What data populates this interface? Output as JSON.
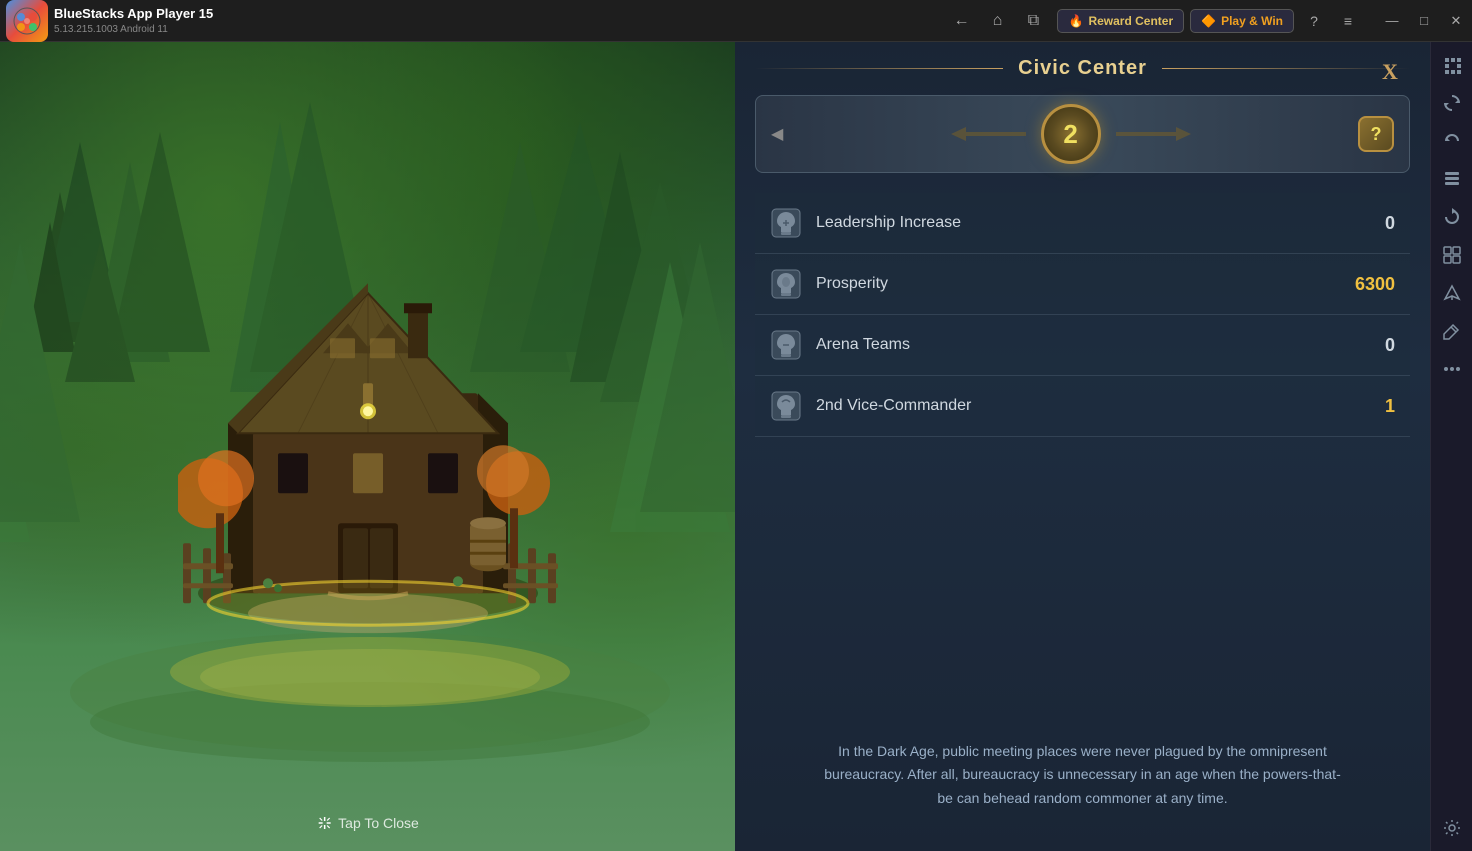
{
  "titlebar": {
    "app_name": "BlueStacks App Player 15",
    "version": "5.13.215.1003  Android 11",
    "nav": {
      "back": "←",
      "home": "⌂",
      "recent": "⧉"
    },
    "reward_center_label": "Reward Center",
    "play_win_label": "Play & Win",
    "reward_icon": "🔥",
    "play_icon": "🔶"
  },
  "window_controls": {
    "help": "?",
    "menu": "≡",
    "minimize": "—",
    "maximize": "□",
    "close": "✕"
  },
  "panel": {
    "title": "Civic Center",
    "close_label": "X",
    "level": "2",
    "help_label": "?"
  },
  "stats": [
    {
      "id": "leadership-increase",
      "name": "Leadership Increase",
      "value": "0",
      "value_type": "zero"
    },
    {
      "id": "prosperity",
      "name": "Prosperity",
      "value": "6300",
      "value_type": "gold"
    },
    {
      "id": "arena-teams",
      "name": "Arena Teams",
      "value": "0",
      "value_type": "zero"
    },
    {
      "id": "vice-commander",
      "name": "2nd Vice-Commander",
      "value": "1",
      "value_type": "gold"
    }
  ],
  "description": "In the Dark Age, public meeting places were never plagued by the omnipresent bureaucracy. After all, bureaucracy is unnecessary in an age when the powers-that-be can behead random commoner at any time.",
  "tap_to_close": "Tap To Close",
  "sidebar_icons": [
    "⛶",
    "↺",
    "↩",
    "⊞",
    "⟳",
    "⊡",
    "✈",
    "✎",
    "✕✕",
    "⚙"
  ]
}
